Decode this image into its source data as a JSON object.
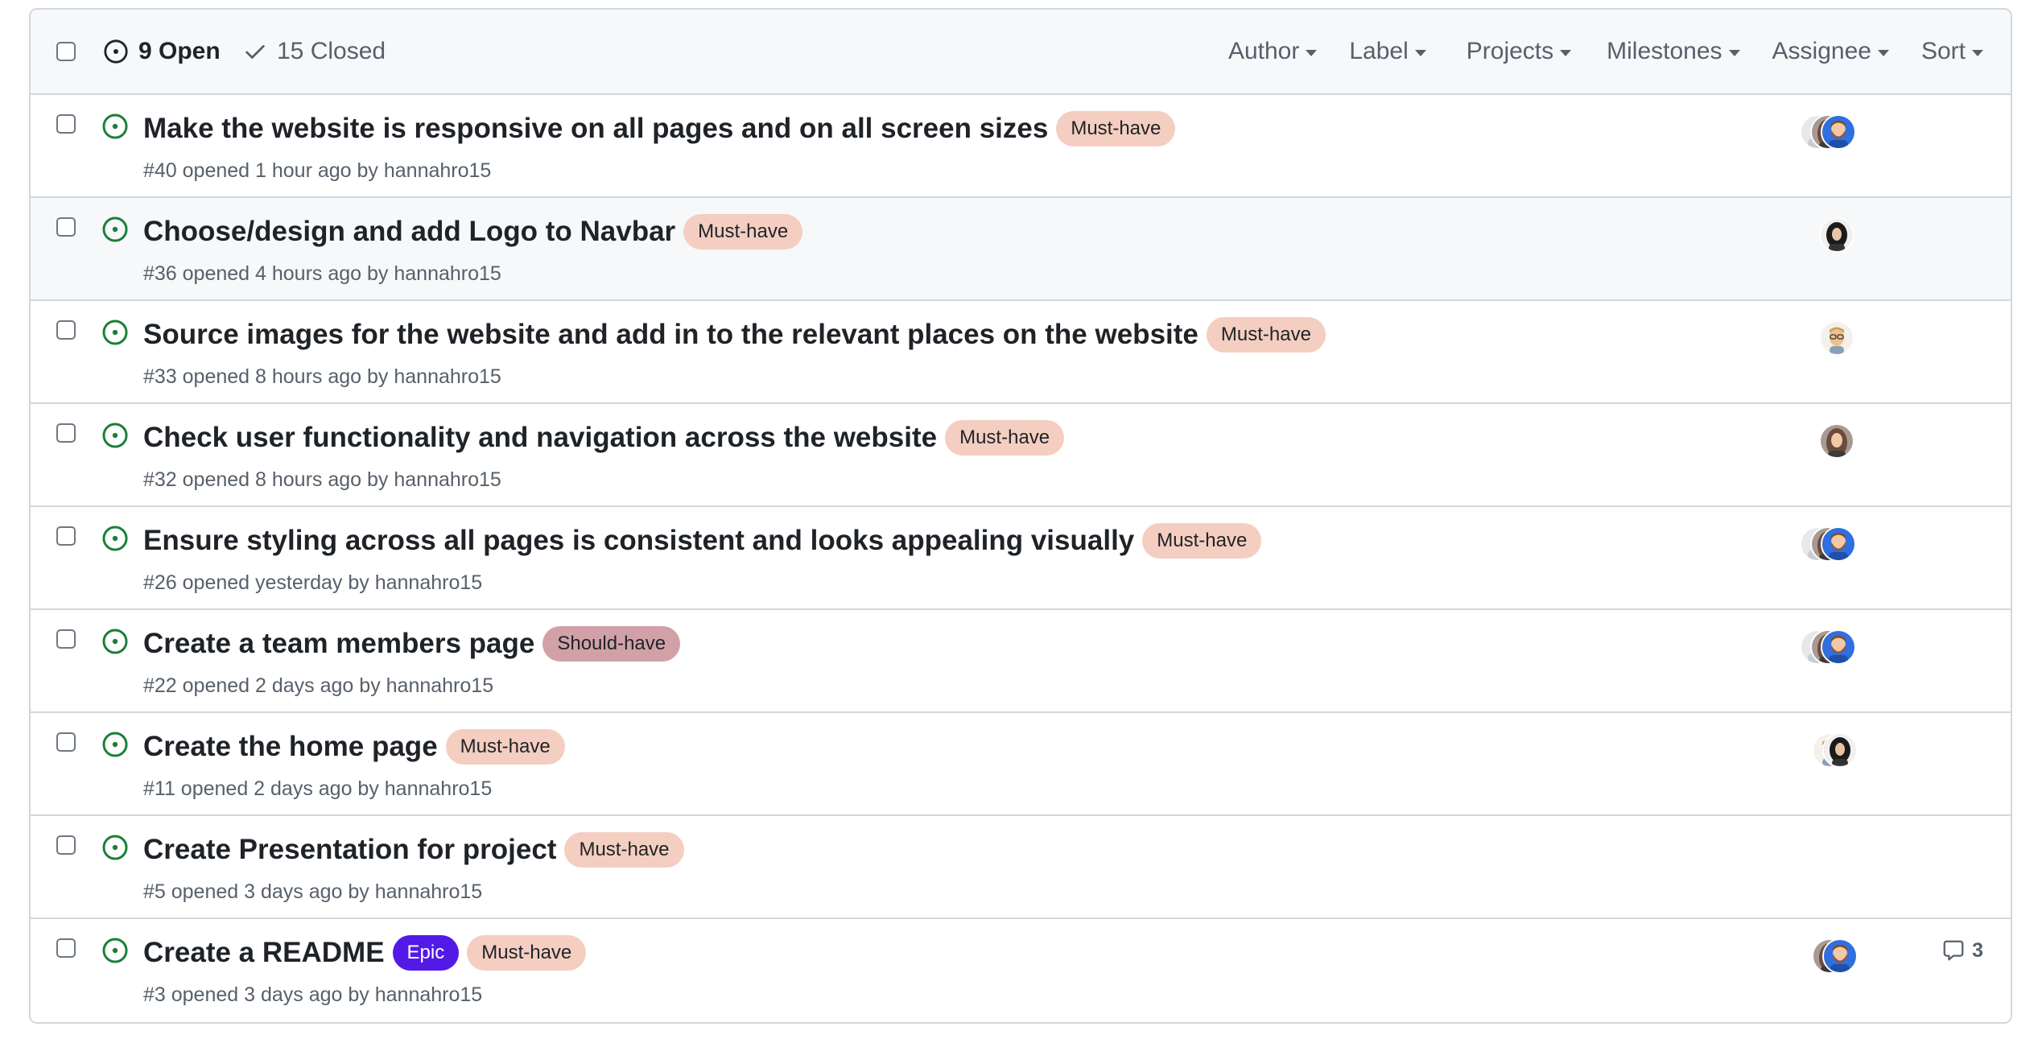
{
  "header": {
    "open_count": "9 Open",
    "closed_count": "15 Closed",
    "filters": [
      {
        "label": "Author",
        "name": "author"
      },
      {
        "label": "Label",
        "name": "label"
      },
      {
        "label": "Projects",
        "name": "projects"
      },
      {
        "label": "Milestones",
        "name": "milestones"
      },
      {
        "label": "Assignee",
        "name": "assignee"
      },
      {
        "label": "Sort",
        "name": "sort"
      }
    ]
  },
  "colors": {
    "open_icon": "#1a7f37",
    "must_have_bg": "#f4cec0",
    "should_have_bg": "#d2a1a8",
    "epic_bg": "#5319e7",
    "epic_text": "#ffffff"
  },
  "issues": [
    {
      "title": "Make the website is responsive on all pages and on all screen sizes",
      "labels": [
        {
          "text": "Must-have",
          "kind": "must"
        }
      ],
      "meta": "#40 opened 1 hour ago by hannahro15",
      "avatars": [
        "grey",
        "woman-brown",
        "man-beard"
      ],
      "comments": ""
    },
    {
      "title": "Choose/design and add Logo to Navbar",
      "labels": [
        {
          "text": "Must-have",
          "kind": "must"
        }
      ],
      "meta": "#36 opened 4 hours ago by hannahro15",
      "avatars": [
        "woman-dark"
      ],
      "comments": ""
    },
    {
      "title": "Source images for the website and add in to the relevant places on the website",
      "labels": [
        {
          "text": "Must-have",
          "kind": "must"
        }
      ],
      "meta": "#33 opened 8 hours ago by hannahro15",
      "avatars": [
        "man-glasses"
      ],
      "comments": ""
    },
    {
      "title": "Check user functionality and navigation across the website",
      "labels": [
        {
          "text": "Must-have",
          "kind": "must"
        }
      ],
      "meta": "#32 opened 8 hours ago by hannahro15",
      "avatars": [
        "woman-brown"
      ],
      "comments": ""
    },
    {
      "title": "Ensure styling across all pages is consistent and looks appealing visually",
      "labels": [
        {
          "text": "Must-have",
          "kind": "must"
        }
      ],
      "meta": "#26 opened yesterday by hannahro15",
      "avatars": [
        "grey",
        "woman-brown",
        "man-beard"
      ],
      "comments": ""
    },
    {
      "title": "Create a team members page",
      "labels": [
        {
          "text": "Should-have",
          "kind": "should"
        }
      ],
      "meta": "#22 opened 2 days ago by hannahro15",
      "avatars": [
        "grey",
        "woman-brown",
        "man-beard"
      ],
      "comments": ""
    },
    {
      "title": "Create the home page",
      "labels": [
        {
          "text": "Must-have",
          "kind": "must"
        }
      ],
      "meta": "#11 opened 2 days ago by hannahro15",
      "avatars": [
        "man-glasses",
        "woman-dark"
      ],
      "comments": ""
    },
    {
      "title": "Create Presentation for project",
      "labels": [
        {
          "text": "Must-have",
          "kind": "must"
        }
      ],
      "meta": "#5 opened 3 days ago by hannahro15",
      "avatars": [],
      "comments": ""
    },
    {
      "title": "Create a README",
      "labels": [
        {
          "text": "Epic",
          "kind": "epic"
        },
        {
          "text": "Must-have",
          "kind": "must"
        }
      ],
      "meta": "#3 opened 3 days ago by hannahro15",
      "avatars": [
        "woman-brown",
        "man-beard"
      ],
      "comments": "3"
    }
  ]
}
